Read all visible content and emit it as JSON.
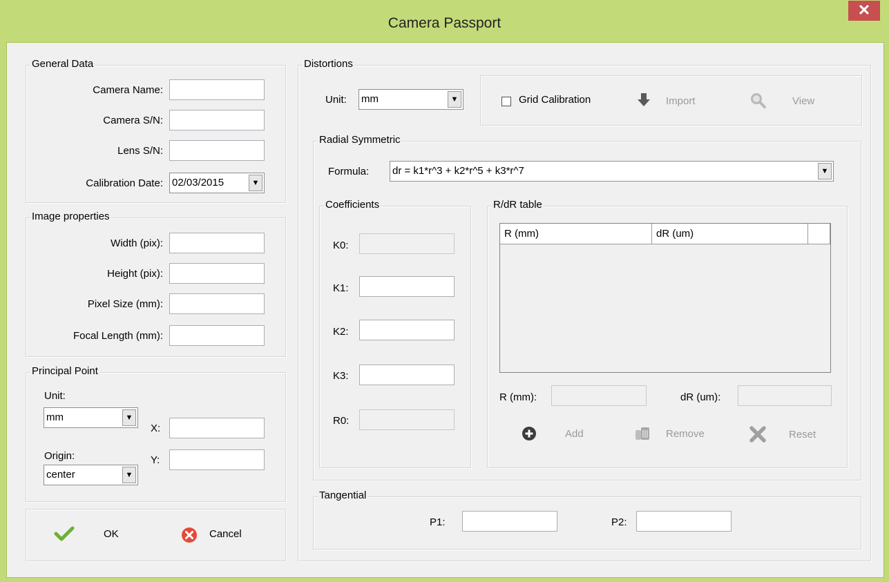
{
  "window": {
    "title": "Camera Passport",
    "close_label": "✕"
  },
  "general": {
    "legend": "General Data",
    "camera_name_label": "Camera Name:",
    "camera_name_value": "",
    "camera_sn_label": "Camera S/N:",
    "camera_sn_value": "",
    "lens_sn_label": "Lens S/N:",
    "lens_sn_value": "",
    "calibration_date_label": "Calibration Date:",
    "calibration_date_value": "02/03/2015"
  },
  "image": {
    "legend": "Image properties",
    "width_label": "Width (pix):",
    "width_value": "",
    "height_label": "Height (pix):",
    "height_value": "",
    "pixel_size_label": "Pixel Size (mm):",
    "pixel_size_value": "",
    "focal_length_label": "Focal Length (mm):",
    "focal_length_value": ""
  },
  "principal": {
    "legend": "Principal Point",
    "unit_label": "Unit:",
    "unit_value": "mm",
    "origin_label": "Origin:",
    "origin_value": "center",
    "x_label": "X:",
    "x_value": "",
    "y_label": "Y:",
    "y_value": ""
  },
  "actions": {
    "ok_label": "OK",
    "cancel_label": "Cancel"
  },
  "distortions": {
    "legend": "Distortions",
    "unit_label": "Unit:",
    "unit_value": "mm",
    "grid_calibration_label": "Grid Calibration",
    "grid_calibration_checked": false,
    "import_label": "Import",
    "view_label": "View"
  },
  "radial": {
    "legend": "Radial Symmetric",
    "formula_label": "Formula:",
    "formula_value": "dr = k1*r^3 + k2*r^5 + k3*r^7"
  },
  "coefficients": {
    "legend": "Coefficients",
    "k0_label": "K0:",
    "k1_label": "K1:",
    "k2_label": "K2:",
    "k3_label": "K3:",
    "r0_label": "R0:"
  },
  "rdr_table": {
    "legend": "R/dR table",
    "columns": [
      "R (mm)",
      "dR (um)"
    ],
    "r_label": "R (mm):",
    "dr_label": "dR (um):",
    "add_label": "Add",
    "remove_label": "Remove",
    "reset_label": "Reset"
  },
  "tangential": {
    "legend": "Tangential",
    "p1_label": "P1:",
    "p2_label": "P2:"
  }
}
